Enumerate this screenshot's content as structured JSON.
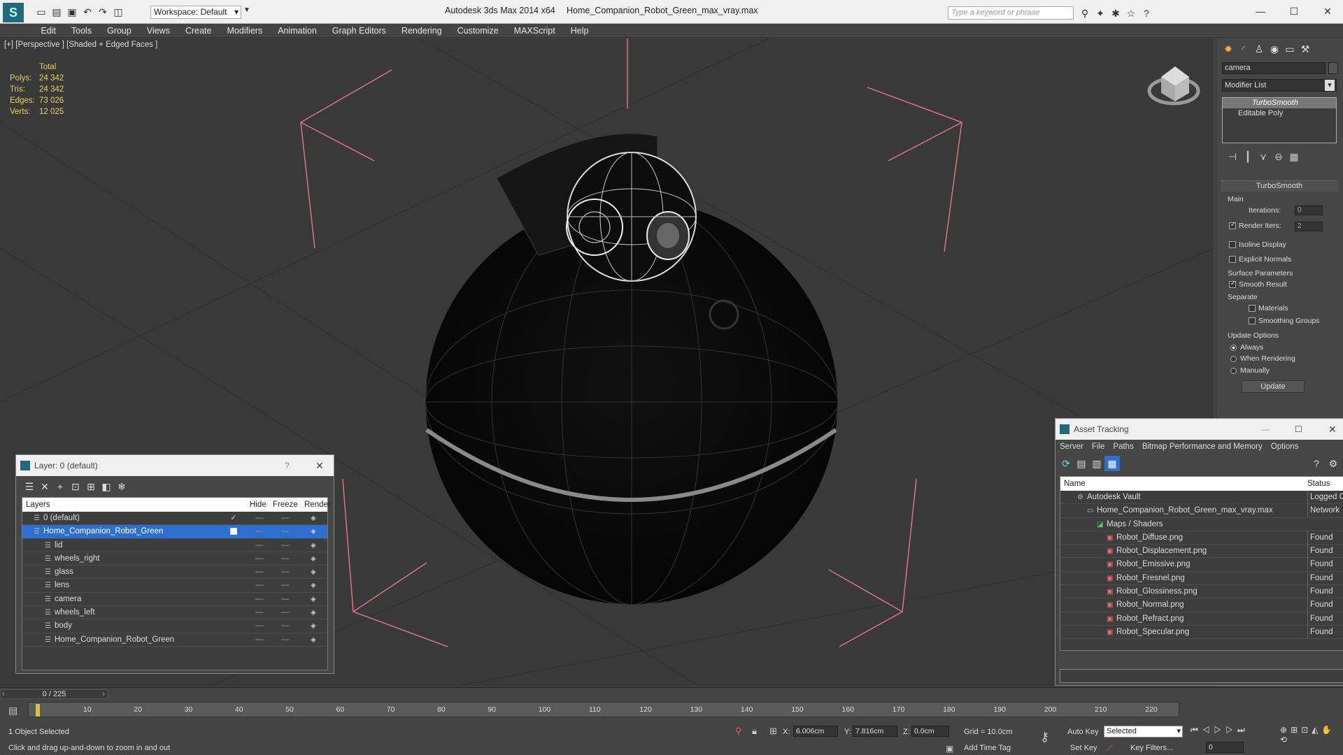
{
  "window": {
    "app_title": "Autodesk 3ds Max  2014 x64",
    "file_title": "Home_Companion_Robot_Green_max_vray.max",
    "workspace_label": "Workspace: Default",
    "search_placeholder": "Type a keyword or phrase"
  },
  "menu": [
    "Edit",
    "Tools",
    "Group",
    "Views",
    "Create",
    "Modifiers",
    "Animation",
    "Graph Editors",
    "Rendering",
    "Customize",
    "MAXScript",
    "Help"
  ],
  "viewport": {
    "label": "[+] [Perspective ] [Shaded + Edged Faces ]",
    "stats_header": "Total",
    "stats": [
      {
        "label": "Polys:",
        "value": "24 342"
      },
      {
        "label": "Tris:",
        "value": "24 342"
      },
      {
        "label": "Edges:",
        "value": "73 026"
      },
      {
        "label": "Verts:",
        "value": "12 025"
      }
    ]
  },
  "command_panel": {
    "object_name": "camera",
    "modifier_list_label": "Modifier List",
    "stack": [
      "TurboSmooth",
      "Editable Poly"
    ],
    "rollout_title": "TurboSmooth",
    "main_label": "Main",
    "iterations_label": "Iterations:",
    "iterations_value": "0",
    "render_iters_label": "Render Iters:",
    "render_iters_value": "2",
    "isoline_label": "Isoline Display",
    "explicit_normals_label": "Explicit Normals",
    "surface_params_label": "Surface Parameters",
    "smooth_result_label": "Smooth Result",
    "separate_label": "Separate",
    "materials_label": "Materials",
    "smoothing_groups_label": "Smoothing Groups",
    "update_options_label": "Update Options",
    "always_label": "Always",
    "when_rendering_label": "When Rendering",
    "manually_label": "Manually",
    "update_button": "Update"
  },
  "layer_dialog": {
    "title": "Layer: 0 (default)",
    "help": "?",
    "col_layers": "Layers",
    "col_hide": "Hide",
    "col_freeze": "Freeze",
    "col_render": "Render",
    "rows": [
      {
        "name": "0 (default)",
        "indent": 1,
        "selected": false
      },
      {
        "name": "Home_Companion_Robot_Green",
        "indent": 1,
        "selected": true
      },
      {
        "name": "lid",
        "indent": 2,
        "selected": false
      },
      {
        "name": "wheels_right",
        "indent": 2,
        "selected": false
      },
      {
        "name": "glass",
        "indent": 2,
        "selected": false
      },
      {
        "name": "lens",
        "indent": 2,
        "selected": false
      },
      {
        "name": "camera",
        "indent": 2,
        "selected": false
      },
      {
        "name": "wheels_left",
        "indent": 2,
        "selected": false
      },
      {
        "name": "body",
        "indent": 2,
        "selected": false
      },
      {
        "name": "Home_Companion_Robot_Green",
        "indent": 2,
        "selected": false
      }
    ]
  },
  "asset_dialog": {
    "title": "Asset Tracking",
    "menu": [
      "Server",
      "File",
      "Paths",
      "Bitmap Performance and Memory",
      "Options"
    ],
    "col_name": "Name",
    "col_status": "Status",
    "rows": [
      {
        "name": "Autodesk Vault",
        "status": "Logged O",
        "indent": 1
      },
      {
        "name": "Home_Companion_Robot_Green_max_vray.max",
        "status": "Network",
        "indent": 2
      },
      {
        "name": "Maps / Shaders",
        "status": "",
        "indent": 3
      },
      {
        "name": "Robot_Diffuse.png",
        "status": "Found",
        "indent": 4
      },
      {
        "name": "Robot_Displacement.png",
        "status": "Found",
        "indent": 4
      },
      {
        "name": "Robot_Emissive.png",
        "status": "Found",
        "indent": 4
      },
      {
        "name": "Robot_Fresnel.png",
        "status": "Found",
        "indent": 4
      },
      {
        "name": "Robot_Glossiness.png",
        "status": "Found",
        "indent": 4
      },
      {
        "name": "Robot_Normal.png",
        "status": "Found",
        "indent": 4
      },
      {
        "name": "Robot_Refract.png",
        "status": "Found",
        "indent": 4
      },
      {
        "name": "Robot_Specular.png",
        "status": "Found",
        "indent": 4
      }
    ]
  },
  "timeline": {
    "frame_counter": "0 / 225",
    "ticks": [
      "10",
      "20",
      "30",
      "40",
      "50",
      "60",
      "70",
      "80",
      "90",
      "100",
      "110",
      "120",
      "130",
      "140",
      "150",
      "160",
      "170",
      "180",
      "190",
      "200",
      "210",
      "220"
    ]
  },
  "status": {
    "selection": "1 Object Selected",
    "prompt": "Click and drag up-and-down to zoom in and out",
    "x_label": "X:",
    "x_value": "6.006cm",
    "y_label": "Y:",
    "y_value": "7.816cm",
    "z_label": "Z:",
    "z_value": "0.0cm",
    "grid": "Grid = 10.0cm",
    "add_time_tag": "Add Time Tag",
    "auto_key": "Auto Key",
    "set_key": "Set Key",
    "selected_dropdown": "Selected",
    "key_filters": "Key Filters...",
    "frame_value": "0"
  }
}
